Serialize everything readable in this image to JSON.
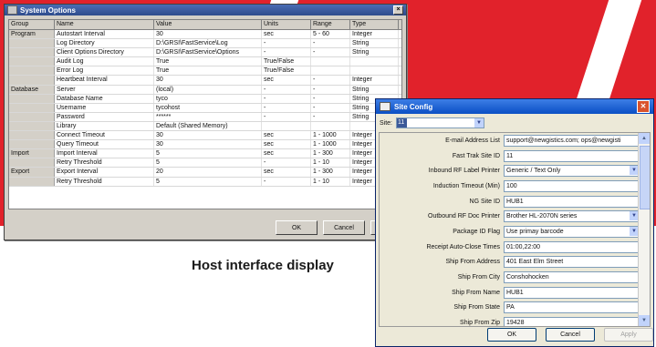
{
  "caption": "Host interface display",
  "system_options": {
    "title": "System Options",
    "columns": [
      "Group",
      "Name",
      "Value",
      "Units",
      "Range",
      "Type"
    ],
    "rows": [
      {
        "group": "Program",
        "name": "Autostart Interval",
        "value": "30",
        "units": "sec",
        "range": "5 - 60",
        "type": "Integer"
      },
      {
        "group": "",
        "name": "Log Directory",
        "value": "D:\\GRSI\\FastService\\Log",
        "units": "-",
        "range": "-",
        "type": "String"
      },
      {
        "group": "",
        "name": "Client Options Directory",
        "value": "D:\\GRSI\\FastService\\Options",
        "units": "-",
        "range": "-",
        "type": "String"
      },
      {
        "group": "",
        "name": "Audit Log",
        "value": "True",
        "units": "True/False",
        "range": "",
        "type": ""
      },
      {
        "group": "",
        "name": "Error Log",
        "value": "True",
        "units": "True/False",
        "range": "",
        "type": ""
      },
      {
        "group": "",
        "name": "Heartbeat Interval",
        "value": "30",
        "units": "sec",
        "range": "-",
        "type": "Integer"
      },
      {
        "group": "Database",
        "name": "Server",
        "value": "(local)",
        "units": "-",
        "range": "-",
        "type": "String"
      },
      {
        "group": "",
        "name": "Database Name",
        "value": "tyco",
        "units": "-",
        "range": "-",
        "type": "String"
      },
      {
        "group": "",
        "name": "Username",
        "value": "tycohost",
        "units": "-",
        "range": "-",
        "type": "String"
      },
      {
        "group": "",
        "name": "Password",
        "value": "******",
        "units": "-",
        "range": "-",
        "type": "String"
      },
      {
        "group": "",
        "name": "Library",
        "value": "Default (Shared Memory)",
        "units": "",
        "range": "",
        "type": ""
      },
      {
        "group": "",
        "name": "Connect Timeout",
        "value": "30",
        "units": "sec",
        "range": "1 - 1000",
        "type": "Integer"
      },
      {
        "group": "",
        "name": "Query Timeout",
        "value": "30",
        "units": "sec",
        "range": "1 - 1000",
        "type": "Integer"
      },
      {
        "group": "Import",
        "name": "Import Interval",
        "value": "5",
        "units": "sec",
        "range": "1 - 300",
        "type": "Integer"
      },
      {
        "group": "",
        "name": "Retry Threshold",
        "value": "5",
        "units": "-",
        "range": "1 - 10",
        "type": "Integer"
      },
      {
        "group": "Export",
        "name": "Export Interval",
        "value": "20",
        "units": "sec",
        "range": "1 - 300",
        "type": "Integer"
      },
      {
        "group": "",
        "name": "Retry Threshold",
        "value": "5",
        "units": "-",
        "range": "1 - 10",
        "type": "Integer"
      }
    ],
    "ok_label": "OK",
    "cancel_label": "Cancel",
    "apply_label": "A"
  },
  "site_config": {
    "title": "Site Config",
    "site_label": "Site:",
    "site_value": "11",
    "fields": [
      {
        "label": "E-mail Address List",
        "value": "support@newgistics.com; ops@newgisti",
        "dropdown": false
      },
      {
        "label": "Fast Trak Site ID",
        "value": "11",
        "dropdown": false
      },
      {
        "label": "Inbound RF Label Printer",
        "value": "Generic / Text Only",
        "dropdown": true
      },
      {
        "label": "Induction Timeout (Min)",
        "value": "100",
        "dropdown": false
      },
      {
        "label": "NG Site ID",
        "value": "HUB1",
        "dropdown": false
      },
      {
        "label": "Outbound RF Doc Printer",
        "value": "Brother HL-2070N series",
        "dropdown": true
      },
      {
        "label": "Package ID Flag",
        "value": "Use primay barcode",
        "dropdown": true
      },
      {
        "label": "Receipt Auto-Close Times",
        "value": "01:00,22:00",
        "dropdown": false
      },
      {
        "label": "Ship From Address",
        "value": "401 East Elm Street",
        "dropdown": false
      },
      {
        "label": "Ship From City",
        "value": "Conshohocken",
        "dropdown": false
      },
      {
        "label": "Ship From Name",
        "value": "HUB1",
        "dropdown": false
      },
      {
        "label": "Ship From State",
        "value": "PA",
        "dropdown": false
      },
      {
        "label": "Ship From Zip",
        "value": "19428",
        "dropdown": false
      }
    ],
    "ok_label": "OK",
    "cancel_label": "Cancel",
    "apply_label": "Apply"
  },
  "colors": {
    "background_red": "#e1222b",
    "titlebar_blue": "#0a4fc4"
  }
}
